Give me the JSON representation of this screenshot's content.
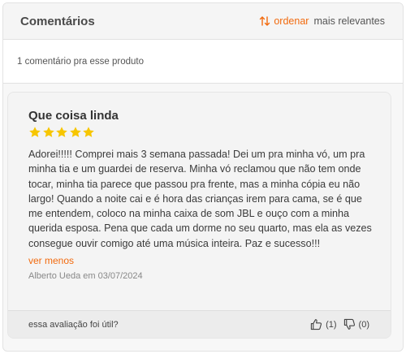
{
  "header": {
    "title": "Comentários",
    "sort_label": "ordenar",
    "sort_value": "mais relevantes"
  },
  "summary": {
    "count_text": "1 comentário pra esse produto"
  },
  "review": {
    "title": "Que coisa linda",
    "rating": 5,
    "text": "Adorei!!!!! Comprei mais 3 semana passada! Dei um pra minha vó, um pra minha tia e um guardei de reserva. Minha vó reclamou que não tem onde tocar, minha tia parece que passou pra frente, mas a minha cópia eu não largo! Quando a noite cai e é hora das crianças irem para cama, se é que me entendem, coloco na minha caixa de som JBL e ouço com a minha querida esposa. Pena que cada um dorme no seu quarto, mas ela as vezes consegue ouvir comigo até uma música inteira. Paz e sucesso!!!",
    "toggle_label": "ver menos",
    "author_line": "Alberto Ueda em 03/07/2024",
    "helpful_question": "essa avaliação foi útil?",
    "likes": "(1)",
    "dislikes": "(0)"
  },
  "colors": {
    "accent": "#f26a0e",
    "star": "#f7c600"
  }
}
